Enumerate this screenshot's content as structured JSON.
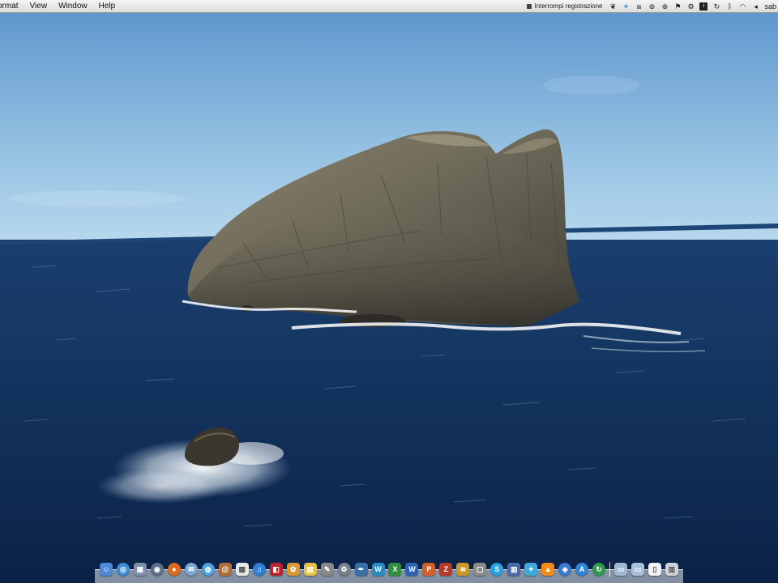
{
  "menubar": {
    "menus": [
      "ormat",
      "View",
      "Window",
      "Help"
    ],
    "recording_label": "Interrompi registrazione",
    "status_icons": [
      "stop-recording-icon",
      "evernote-icon",
      "twitter-icon",
      "dropbox-icon",
      "skype-icon",
      "lastfm-icon",
      "security-icon",
      "reader-icon",
      "info-icon",
      "sync-icon",
      "bluetooth-icon",
      "wifi-icon",
      "volume-icon"
    ],
    "user": "sab"
  },
  "desktop": {
    "wallpaper": "sea-stack-rock"
  },
  "dock": {
    "apps": [
      {
        "name": "finder-icon",
        "color": "#4a8ad6",
        "glyph": "☺"
      },
      {
        "name": "safari-icon",
        "color": "#3b8fd9",
        "glyph": "◎",
        "round": true
      },
      {
        "name": "preview-icon",
        "color": "#7f8fa8",
        "glyph": "▣"
      },
      {
        "name": "dashboard-icon",
        "color": "#5a6e86",
        "glyph": "◉",
        "round": true
      },
      {
        "name": "firefox-icon",
        "color": "#e06a1c",
        "glyph": "●",
        "round": true
      },
      {
        "name": "mail-icon",
        "color": "#7aa7d6",
        "glyph": "✉",
        "round": true
      },
      {
        "name": "ichat-icon",
        "color": "#4ca3e0",
        "glyph": "◍",
        "round": true
      },
      {
        "name": "address-book-icon",
        "color": "#b06f3a",
        "glyph": "@"
      },
      {
        "name": "calendar-icon",
        "color": "#e8e8e8",
        "glyph": "▦"
      },
      {
        "name": "itunes-icon",
        "color": "#2e7fd5",
        "glyph": "♫",
        "round": true
      },
      {
        "name": "photo-booth-icon",
        "color": "#b8242b",
        "glyph": "◧"
      },
      {
        "name": "iphoto-icon",
        "color": "#d89a2e",
        "glyph": "✿"
      },
      {
        "name": "stickies-icon",
        "color": "#e8c14a",
        "glyph": "▤"
      },
      {
        "name": "script-editor-icon",
        "color": "#888888",
        "glyph": "✎"
      },
      {
        "name": "system-preferences-icon",
        "color": "#7a7f88",
        "glyph": "⚙",
        "round": true
      },
      {
        "name": "xcode-icon",
        "color": "#3a6ea8",
        "glyph": "✒"
      },
      {
        "name": "wordpress-icon",
        "color": "#2a8cc4",
        "glyph": "W"
      },
      {
        "name": "excel-icon",
        "color": "#2f8f3f",
        "glyph": "X"
      },
      {
        "name": "word-icon",
        "color": "#2d62b3",
        "glyph": "W"
      },
      {
        "name": "powerpoint-icon",
        "color": "#d2602a",
        "glyph": "P"
      },
      {
        "name": "filezilla-icon",
        "color": "#b53a2a",
        "glyph": "Z"
      },
      {
        "name": "grapher-icon",
        "color": "#c79a2a",
        "glyph": "≋"
      },
      {
        "name": "screen-capture-icon",
        "color": "#8a8a8a",
        "glyph": "▢"
      },
      {
        "name": "skype-dock-icon",
        "color": "#25a3e6",
        "glyph": "S",
        "round": true
      },
      {
        "name": "spaces-icon",
        "color": "#4a6aa8",
        "glyph": "▥"
      },
      {
        "name": "tweetdeck-icon",
        "color": "#3fa9dc",
        "glyph": "✦"
      },
      {
        "name": "vlc-icon",
        "color": "#f08a1a",
        "glyph": "▲"
      },
      {
        "name": "network-icon",
        "color": "#3a7bd0",
        "glyph": "◈",
        "round": true
      },
      {
        "name": "app-store-icon",
        "color": "#2e86d8",
        "glyph": "A",
        "round": true
      },
      {
        "name": "time-machine-icon",
        "color": "#2f9a4a",
        "glyph": "↻",
        "round": true
      }
    ],
    "stack_items": [
      {
        "name": "applications-folder-icon",
        "color": "#9fb8d8",
        "glyph": "▭"
      },
      {
        "name": "downloads-folder-icon",
        "color": "#a9c0dc",
        "glyph": "▭"
      },
      {
        "name": "document-icon",
        "color": "#f2f2f2",
        "glyph": "▯"
      },
      {
        "name": "trash-icon",
        "color": "#cfd4da",
        "glyph": "▥"
      }
    ]
  }
}
